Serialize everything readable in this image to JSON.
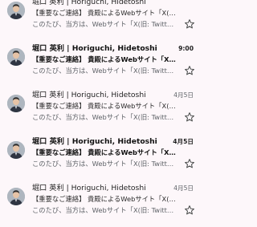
{
  "emails": [
    {
      "sender": "堀口 英利 | Horiguchi, Hidetoshi",
      "subject": "【重要なご連絡】 貴殿によるWebサイト「X(旧: Twitter)",
      "snippet": "このたび、当方は、Webサイト「X(旧: Twitter)」に…",
      "date": "",
      "unread": false
    },
    {
      "sender": "堀口 英利 | Horiguchi, Hidetoshi",
      "subject": "【重要なご連絡】 貴殿によるWebサイト「X(旧: Twi…",
      "snippet": "このたび、当方は、Webサイト「X(旧: Twitter)」に…",
      "date": "9:00",
      "unread": true
    },
    {
      "sender": "堀口 英利 | Horiguchi, Hidetoshi",
      "subject": "【重要なご連絡】 貴殿によるWebサイト「X(旧: Twitter)",
      "snippet": "このたび、当方は、Webサイト「X(旧: Twitter)」に…",
      "date": "4月5日",
      "unread": false
    },
    {
      "sender": "堀口 英利 | Horiguchi, Hidetoshi",
      "subject": "【重要なご連絡】 貴殿によるWebサイト「X(旧: Twi…",
      "snippet": "このたび、当方は、Webサイト「X(旧: Twitter)」に…",
      "date": "4月5日",
      "unread": true
    },
    {
      "sender": "堀口 英利 | Horiguchi, Hidetoshi",
      "subject": "【重要なご連絡】 貴殿によるWebサイト「X(旧: Twitter)",
      "snippet": "このたび、当方は、Webサイト「X(旧: Twitter)」に…",
      "date": "4月5日",
      "unread": false
    }
  ],
  "icons": {
    "avatar": "profile-photo",
    "star": "star-outline-icon"
  },
  "colors": {
    "background": "#fdf7fa",
    "star": "#444746",
    "snippet": "#5f6368"
  }
}
